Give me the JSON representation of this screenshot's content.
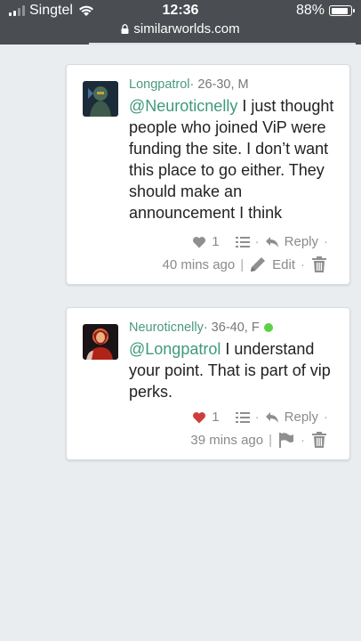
{
  "status": {
    "carrier": "Singtel",
    "time": "12:36",
    "battery": "88%",
    "battery_level": 0.88,
    "url": "similarworlds.com"
  },
  "comments": [
    {
      "username": "Longpatrol",
      "meta": " · 26-30, M",
      "mention": "@Neuroticnelly",
      "text": " I just thought people who joined ViP were funding the site. I don’t want this place to go either. They should make an announcement I think",
      "likes": "1",
      "liked": false,
      "reply_label": "Reply",
      "time": "40 mins ago",
      "edit_label": "Edit"
    },
    {
      "username": "Neuroticnelly",
      "meta": " · 36-40, F",
      "online": true,
      "mention": "@Longpatrol",
      "text": " I understand your point. That is part of vip perks.",
      "likes": "1",
      "liked": true,
      "reply_label": "Reply",
      "time": "39 mins ago"
    }
  ],
  "colors": {
    "accent": "#4a9a7d",
    "like_red": "#d03c3c",
    "online": "#5cd145",
    "statusbar": "#4a4d51"
  }
}
